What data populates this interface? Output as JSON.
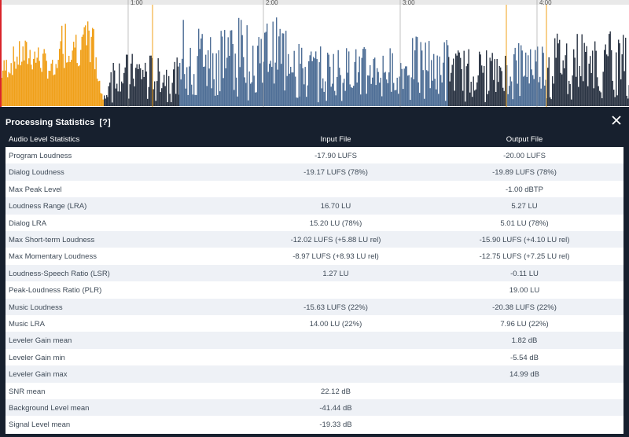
{
  "timeline": {
    "ticks": [
      "1:00",
      "2:00",
      "3:00",
      "4:00"
    ],
    "colors": {
      "music": "#f0a019",
      "speech": "#4e6e96",
      "silence": "#2b3544",
      "marker": "#f0a019"
    }
  },
  "panel": {
    "title": "Processing Statistics",
    "help": "[?]",
    "close_icon": "close-icon",
    "background": "#17202e"
  },
  "table": {
    "headers": {
      "label": "Audio Level Statistics",
      "input": "Input File",
      "output": "Output File"
    },
    "rows": [
      {
        "label": "Program Loudness",
        "input": "-17.90 LUFS",
        "output": "-20.00 LUFS"
      },
      {
        "label": "Dialog Loudness",
        "input": "-19.17 LUFS (78%)",
        "output": "-19.89 LUFS (78%)"
      },
      {
        "label": "Max Peak Level",
        "input": "",
        "output": "-1.00 dBTP"
      },
      {
        "label": "Loudness Range (LRA)",
        "input": "16.70 LU",
        "output": "5.27 LU"
      },
      {
        "label": "Dialog LRA",
        "input": "15.20 LU (78%)",
        "output": "5.01 LU (78%)"
      },
      {
        "label": "Max Short-term Loudness",
        "input": "-12.02 LUFS (+5.88 LU rel)",
        "output": "-15.90 LUFS (+4.10 LU rel)"
      },
      {
        "label": "Max Momentary Loudness",
        "input": "-8.97 LUFS (+8.93 LU rel)",
        "output": "-12.75 LUFS (+7.25 LU rel)"
      },
      {
        "label": "Loudness-Speech Ratio (LSR)",
        "input": "1.27 LU",
        "output": "-0.11 LU"
      },
      {
        "label": "Peak-Loudness Ratio (PLR)",
        "input": "",
        "output": "19.00 LU"
      },
      {
        "label": "Music Loudness",
        "input": "-15.63 LUFS (22%)",
        "output": "-20.38 LUFS (22%)"
      },
      {
        "label": "Music LRA",
        "input": "14.00 LU (22%)",
        "output": "7.96 LU (22%)"
      },
      {
        "label": "Leveler Gain mean",
        "input": "",
        "output": "1.82 dB"
      },
      {
        "label": "Leveler Gain min",
        "input": "",
        "output": "-5.54 dB"
      },
      {
        "label": "Leveler Gain max",
        "input": "",
        "output": "14.99 dB"
      },
      {
        "label": "SNR mean",
        "input": "22.12 dB",
        "output": ""
      },
      {
        "label": "Background Level mean",
        "input": "-41.44 dB",
        "output": ""
      },
      {
        "label": "Signal Level mean",
        "input": "-19.33 dB",
        "output": ""
      }
    ]
  }
}
